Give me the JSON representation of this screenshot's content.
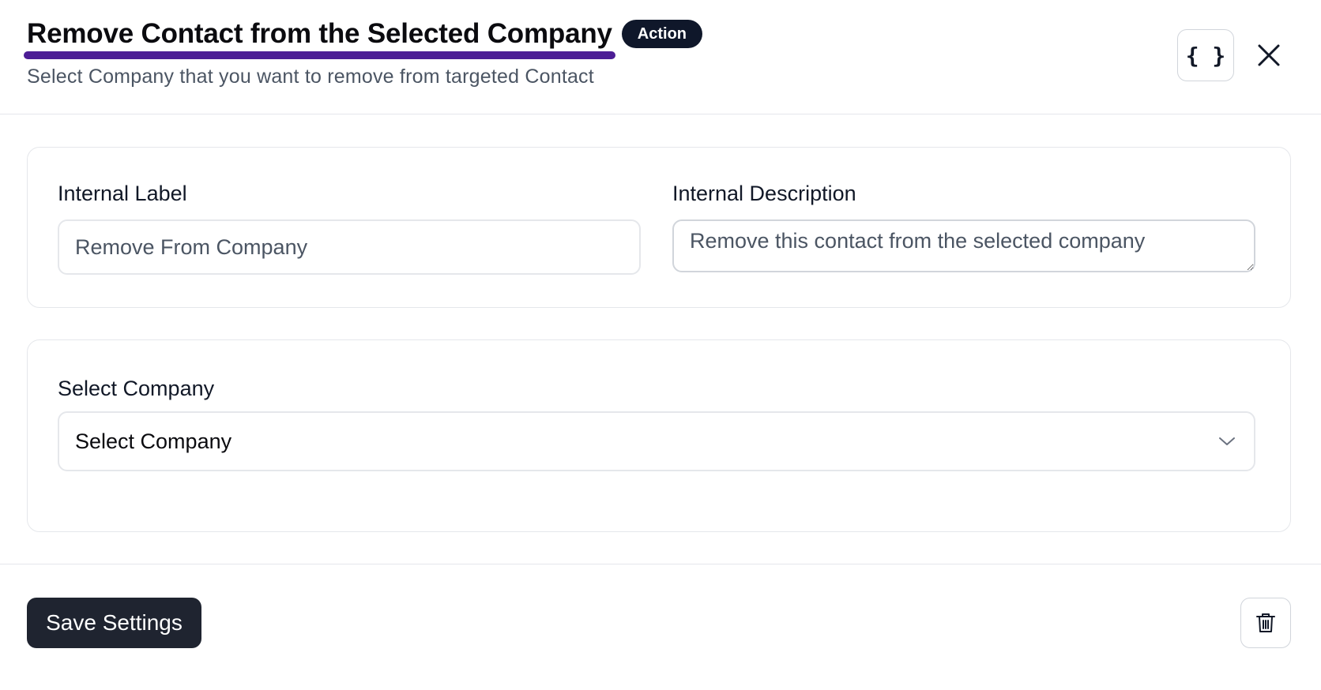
{
  "header": {
    "title": "Remove Contact from the Selected Company",
    "badge": "Action",
    "subtitle": "Select Company that you want to remove from targeted Contact",
    "code_button_label": "{ }"
  },
  "settings": {
    "internal_label": {
      "label": "Internal Label",
      "value": "Remove From Company"
    },
    "internal_description": {
      "label": "Internal Description",
      "value": "Remove this contact from the selected company"
    }
  },
  "company": {
    "label": "Select Company",
    "selected": "Select Company"
  },
  "footer": {
    "save_label": "Save Settings"
  },
  "colors": {
    "accent_underline": "#4c1d95",
    "badge_bg": "#0f172a",
    "primary_button": "#1f2430",
    "border": "#e5e7eb"
  },
  "icons": {
    "code": "code-braces-icon",
    "close": "close-icon",
    "chevron": "chevron-down-icon",
    "trash": "trash-icon"
  }
}
